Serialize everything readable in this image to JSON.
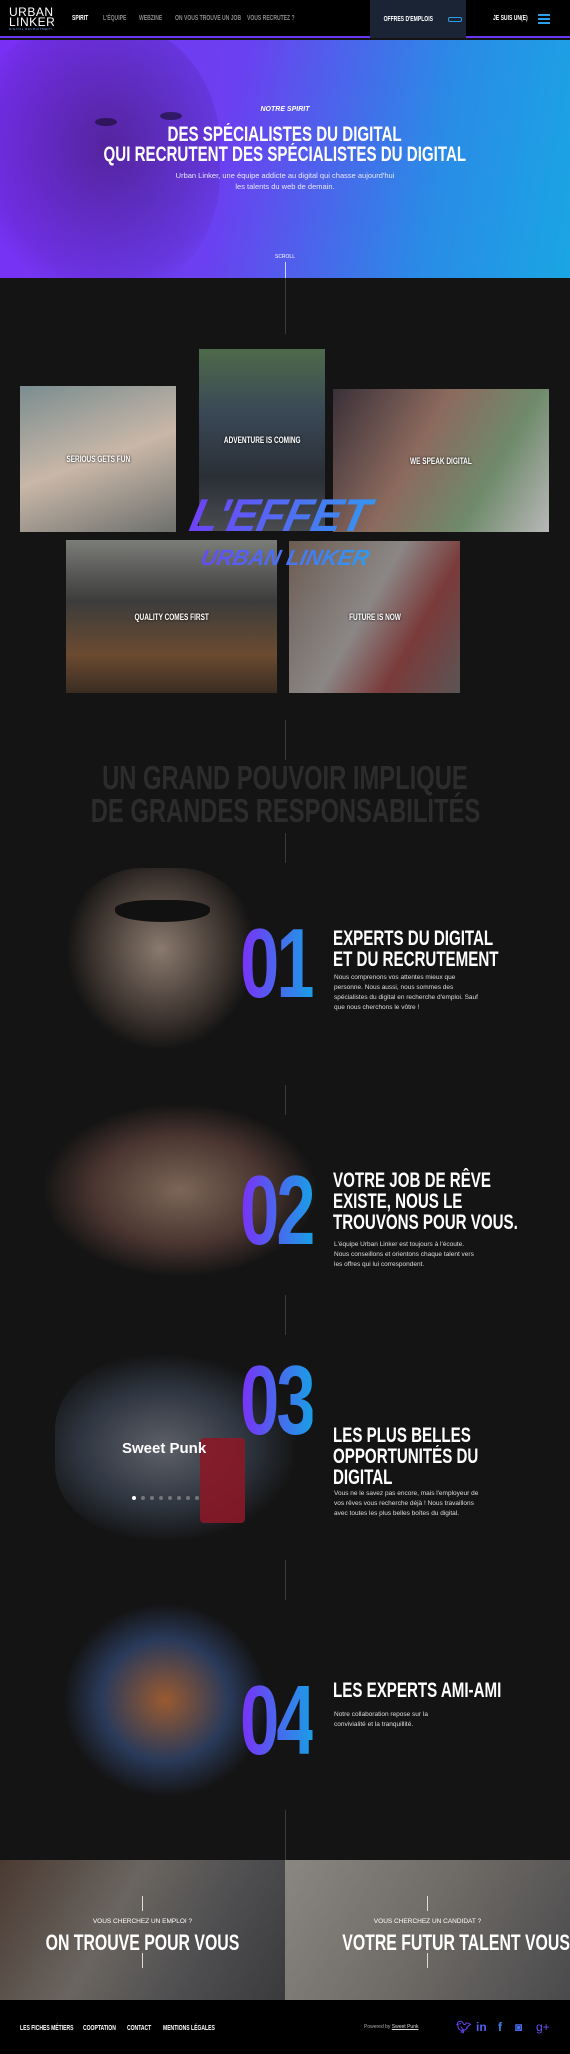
{
  "nav": {
    "logo": {
      "line1": "URBAN",
      "line2": "LINKER",
      "tagline": "DIGITAL RECRUITMENT"
    },
    "items": [
      {
        "label": "SPIRIT",
        "active": true
      },
      {
        "label": "L'ÉQUIPE"
      },
      {
        "label": "WEBZINE"
      },
      {
        "label": "ON VOUS TROUVE UN JOB"
      },
      {
        "label": "VOUS RECRUTEZ ?"
      }
    ],
    "offres_label": "OFFRES D'EMPLOIS",
    "jesuis_label": "JE SUIS UN(E)",
    "menu_icon": "hamburger-icon"
  },
  "hero": {
    "kicker": "NOTRE SPIRIT",
    "title_line1": "DES SPÉCIALISTES DU DIGITAL",
    "title_line2": "QUI RECRUTENT DES SPÉCIALISTES DU DIGITAL",
    "subtitle": "Urban Linker, une équipe addicte au digital qui chasse aujourd'hui les talents du web de demain.",
    "scroll": "SCROLL",
    "gradient": [
      "#7a2ff4",
      "#1aa6e4"
    ]
  },
  "collage": {
    "tiles": [
      {
        "label": "SERIOUS GETS FUN"
      },
      {
        "label": "ADVENTURE IS COMING"
      },
      {
        "label": "WE SPEAK DIGITAL"
      },
      {
        "label": "QUALITY COMES FIRST"
      },
      {
        "label": "FUTURE IS NOW"
      }
    ],
    "title": "L'EFFET",
    "subtitle": "URBAN LINKER"
  },
  "motto": {
    "line1": "UN GRAND POUVOIR IMPLIQUE",
    "line2": "DE GRANDES RESPONSABILITÉS"
  },
  "features": [
    {
      "number": "01",
      "title1": "EXPERTS DU DIGITAL",
      "title2": "ET DU RECRUTEMENT",
      "title3": "",
      "text": "Nous comprenons vos attentes mieux que personne. Nous aussi, nous sommes des spécialistes du digital en recherche d'emploi. Sauf que nous cherchons le vôtre !"
    },
    {
      "number": "02",
      "title1": "VOTRE JOB DE RÊVE",
      "title2": "EXISTE, NOUS LE",
      "title3": "TROUVONS POUR VOUS.",
      "text": "L'équipe Urban Linker est toujours à l'écoute. Nous conseillons et orientons chaque talent vers les offres qui lui correspondent."
    },
    {
      "number": "03",
      "title1": "LES PLUS BELLES",
      "title2": "OPPORTUNITÉS DU",
      "title3": "DIGITAL",
      "text": "Vous ne le savez pas encore, mais l'employeur de vos rêves vous recherche déjà ! Nous travaillons avec toutes les plus belles boîtes du digital.",
      "photo_caption": "Sweet Punk",
      "carousel_dots": 8,
      "carousel_active": 1
    },
    {
      "number": "04",
      "title1": "LES EXPERTS AMI-AMI",
      "title2": "",
      "title3": "",
      "text": "Notre collaboration repose sur la convivialité et la tranquillité."
    }
  ],
  "cta": [
    {
      "kicker": "VOUS CHERCHEZ UN EMPLOI ?",
      "title": "ON TROUVE POUR VOUS"
    },
    {
      "kicker": "VOUS CHERCHEZ UN CANDIDAT ?",
      "title": "VOTRE FUTUR TALENT VOUS ATTEND"
    }
  ],
  "footer": {
    "links": [
      "LES FICHES MÉTIERS",
      "COOPTATION",
      "CONTACT",
      "MENTIONS LÉGALES"
    ],
    "powered_prefix": "Powered by",
    "powered_link": "Sweet Punk",
    "social": [
      {
        "icon": "twitter-icon",
        "glyph": "🐦︎"
      },
      {
        "icon": "linkedin-icon",
        "glyph": "in"
      },
      {
        "icon": "facebook-icon",
        "glyph": "f"
      },
      {
        "icon": "instagram-icon",
        "glyph": "◙"
      },
      {
        "icon": "google-plus-icon",
        "glyph": "g+"
      }
    ]
  }
}
